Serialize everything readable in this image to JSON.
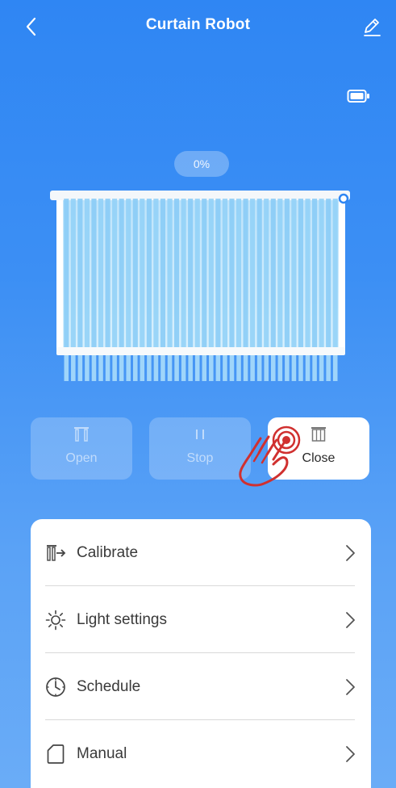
{
  "header": {
    "title": "Curtain Robot",
    "back_icon": "chevron-left-icon",
    "edit_icon": "pencil-icon"
  },
  "status": {
    "battery_icon": "battery-icon",
    "position_percent": "0%"
  },
  "controls": [
    {
      "label": "Open",
      "icon": "curtain-open-icon",
      "active": false
    },
    {
      "label": "Stop",
      "icon": "pause-icon",
      "active": false
    },
    {
      "label": "Close",
      "icon": "curtain-close-icon",
      "active": true
    }
  ],
  "menu": [
    {
      "label": "Calibrate",
      "icon": "calibrate-icon"
    },
    {
      "label": "Light settings",
      "icon": "sun-icon"
    },
    {
      "label": "Schedule",
      "icon": "clock-icon"
    },
    {
      "label": "Manual",
      "icon": "document-icon"
    }
  ],
  "colors": {
    "background_top": "#2f86f3",
    "background_bottom": "#6aacf7",
    "tap_indicator": "#d0302f",
    "curtain_blue": "#8fd0f7"
  }
}
